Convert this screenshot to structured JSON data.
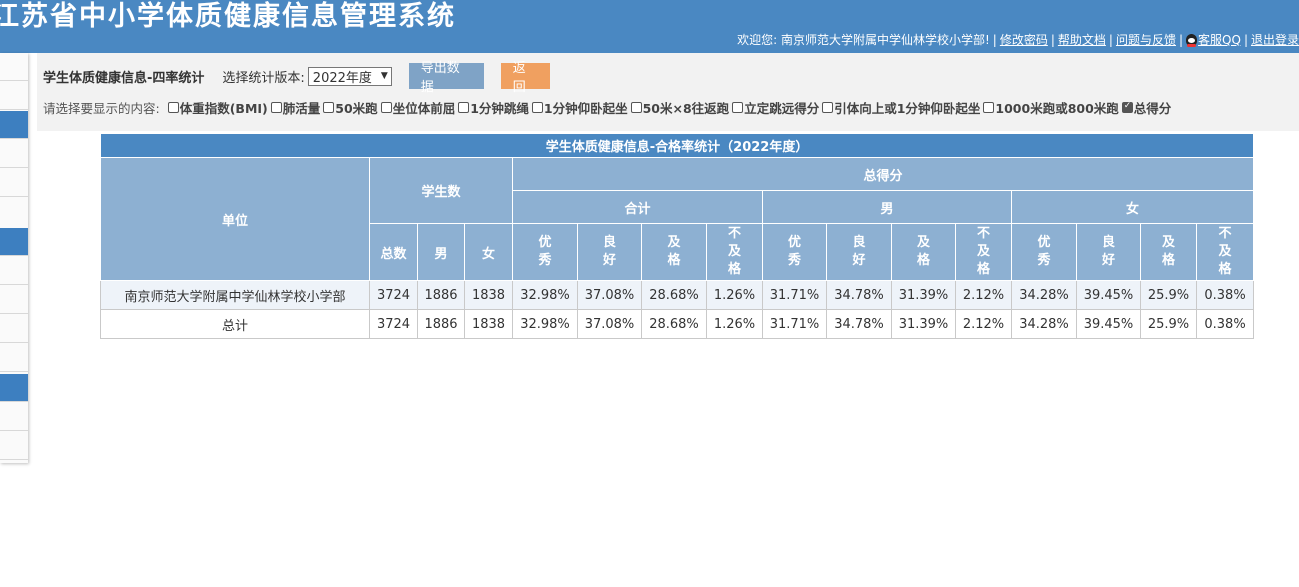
{
  "header": {
    "title": "江苏省中小学体质健康信息管理系统",
    "welcome": "欢迎您: 南京师范大学附属中学仙林学校小学部!",
    "links": [
      "修改密码",
      "帮助文档",
      "问题与反馈",
      "客服QQ",
      "退出登录"
    ]
  },
  "toolbar": {
    "page_title": "学生体质健康信息-四率统计",
    "version_label": "选择统计版本:",
    "version_value": "2022年度",
    "export_label": "导出数据",
    "back_label": "返回",
    "display_prompt": "请选择要显示的内容:",
    "options": [
      {
        "label": "体重指数(BMI)",
        "checked": false
      },
      {
        "label": "肺活量",
        "checked": false
      },
      {
        "label": "50米跑",
        "checked": false
      },
      {
        "label": "坐位体前屈",
        "checked": false
      },
      {
        "label": "1分钟跳绳",
        "checked": false
      },
      {
        "label": "1分钟仰卧起坐",
        "checked": false
      },
      {
        "label": "50米×8往返跑",
        "checked": false
      },
      {
        "label": "立定跳远得分",
        "checked": false
      },
      {
        "label": "引体向上或1分钟仰卧起坐",
        "checked": false
      },
      {
        "label": "1000米跑或800米跑",
        "checked": false
      },
      {
        "label": "总得分",
        "checked": true
      }
    ]
  },
  "table": {
    "caption": "学生体质健康信息-合格率统计（2022年度）",
    "unit_header": "单位",
    "students_header": "学生数",
    "score_header": "总得分",
    "group_headers": [
      "合计",
      "男",
      "女"
    ],
    "student_cols": [
      "总数",
      "男",
      "女"
    ],
    "rate_cols": [
      "优秀",
      "良好",
      "及格",
      "不及格"
    ],
    "rows": [
      {
        "unit": "南京师范大学附属中学仙林学校小学部",
        "values": [
          "3724",
          "1886",
          "1838",
          "32.98%",
          "37.08%",
          "28.68%",
          "1.26%",
          "31.71%",
          "34.78%",
          "31.39%",
          "2.12%",
          "34.28%",
          "39.45%",
          "25.9%",
          "0.38%"
        ]
      },
      {
        "unit": "总计",
        "values": [
          "3724",
          "1886",
          "1838",
          "32.98%",
          "37.08%",
          "28.68%",
          "1.26%",
          "31.71%",
          "34.78%",
          "31.39%",
          "2.12%",
          "34.28%",
          "39.45%",
          "25.9%",
          "0.38%"
        ]
      }
    ]
  },
  "colors": {
    "header_bg": "#4a88c2",
    "table_header_bg": "#8db0d2",
    "export_button": "#7fa3c6",
    "back_button": "#f0a060"
  }
}
